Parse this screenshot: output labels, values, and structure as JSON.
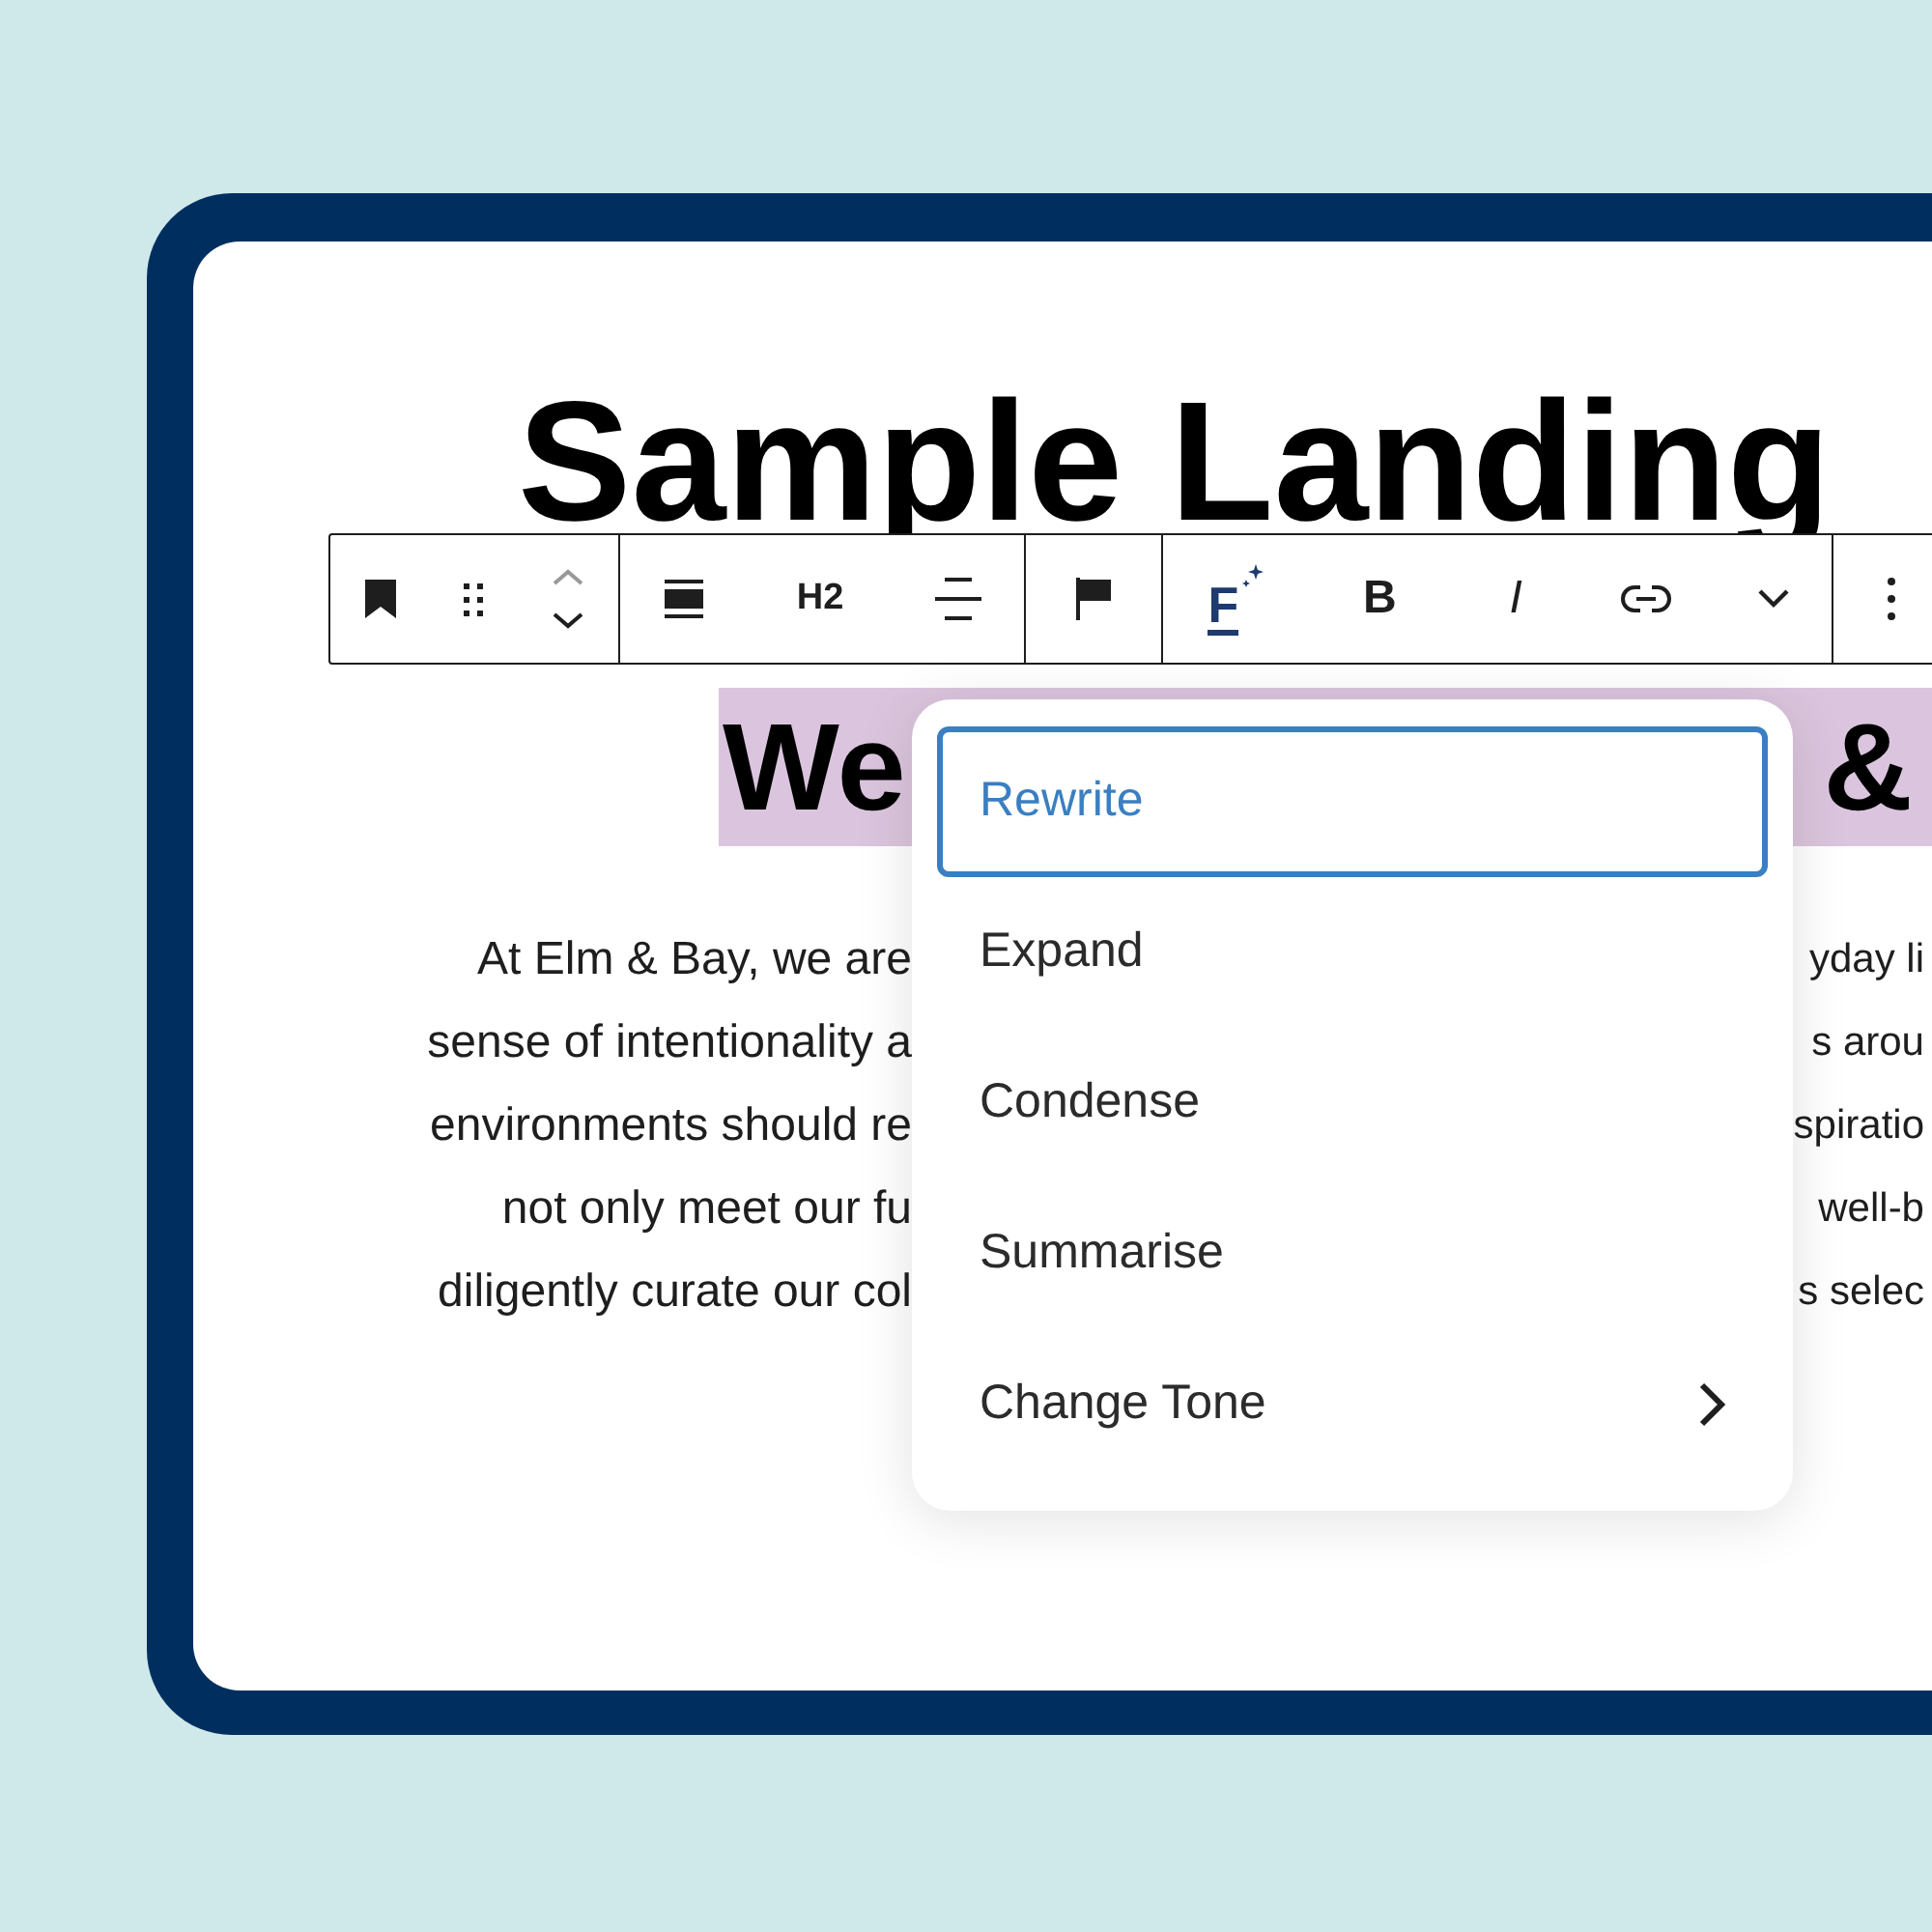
{
  "heading_1": {
    "text": "Sample Landing"
  },
  "block_toolbar": {
    "groups": [
      [
        {
          "kind": "bookmark"
        },
        {
          "kind": "drag"
        },
        {
          "kind": "mover"
        }
      ],
      [
        {
          "kind": "align"
        },
        {
          "kind": "heading",
          "label": "H2"
        },
        {
          "kind": "align-center"
        }
      ],
      [
        {
          "kind": "flag"
        }
      ],
      [
        {
          "kind": "ai",
          "label": "F"
        },
        {
          "kind": "bold",
          "label": "B"
        },
        {
          "kind": "italic",
          "label": "I"
        },
        {
          "kind": "link"
        },
        {
          "kind": "chevron"
        }
      ],
      [
        {
          "kind": "options"
        }
      ]
    ]
  },
  "heading_2": {
    "left": "We",
    "right": "&"
  },
  "paragraph_lines": [
    {
      "left": "At Elm & Bay, we are",
      "right": "yday li"
    },
    {
      "left": "sense of intentionality a",
      "right": "s arou"
    },
    {
      "left": "environments should re",
      "right": "spiratio"
    },
    {
      "left": "not only meet our fu",
      "right": "well-b"
    },
    {
      "left": "diligently curate our col",
      "right": "s selec"
    }
  ],
  "menu": {
    "items": [
      {
        "label": "Rewrite",
        "selected": true,
        "submenu": false
      },
      {
        "label": "Expand",
        "selected": false,
        "submenu": false
      },
      {
        "label": "Condense",
        "selected": false,
        "submenu": false
      },
      {
        "label": "Summarise",
        "selected": false,
        "submenu": false
      },
      {
        "label": "Change Tone",
        "selected": false,
        "submenu": true
      }
    ]
  }
}
